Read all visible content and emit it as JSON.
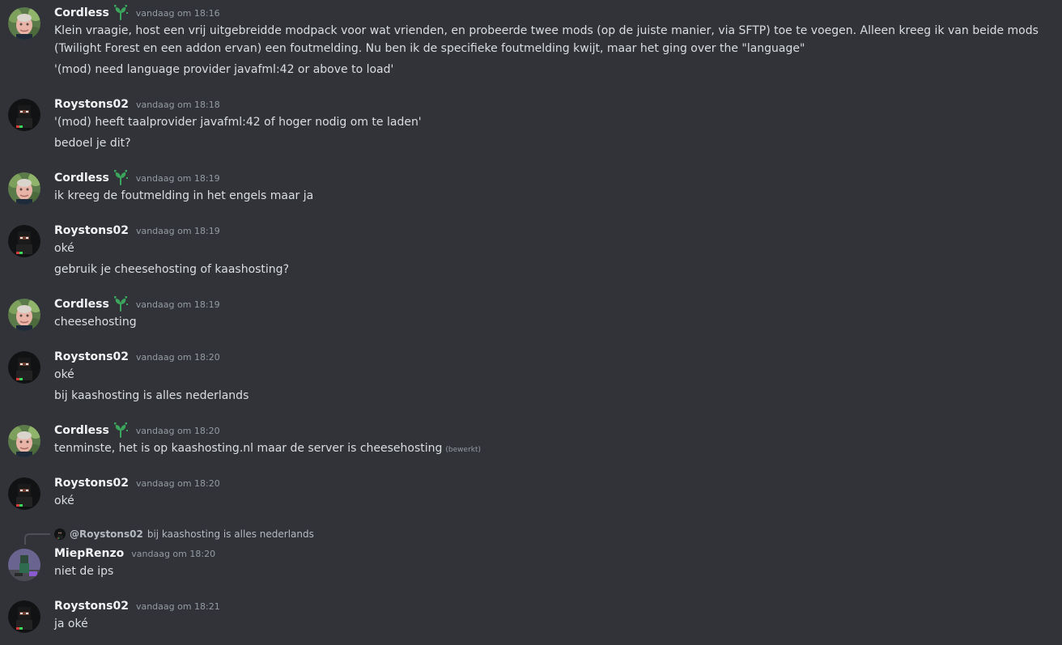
{
  "users": {
    "cordless": {
      "name": "Cordless",
      "badge": "sprout-icon"
    },
    "roystons": {
      "name": "Roystons02"
    },
    "miep": {
      "name": "MiepRenzo"
    }
  },
  "messages": [
    {
      "author": "Cordless",
      "time": "vandaag om 18:16",
      "lines": [
        "Klein vraagie, host een vrij uitgebreidde modpack voor wat vrienden, en probeerde twee mods (op de juiste manier, via SFTP) toe te voegen. Alleen kreeg ik van beide mods (Twilight Forest en een addon ervan) een foutmelding. Nu ben ik de specifieke foutmelding kwijt, maar het ging over the \"language\"",
        "'(mod) need language provider javafml:42 or above to load'"
      ]
    },
    {
      "author": "Roystons02",
      "time": "vandaag om 18:18",
      "lines": [
        "'(mod) heeft taalprovider javafml:42 of hoger nodig om te laden'",
        "bedoel je dit?"
      ]
    },
    {
      "author": "Cordless",
      "time": "vandaag om 18:19",
      "lines": [
        "ik kreeg de foutmelding in het engels maar ja"
      ]
    },
    {
      "author": "Roystons02",
      "time": "vandaag om 18:19",
      "lines": [
        "oké",
        "gebruik je cheesehosting of kaashosting?"
      ]
    },
    {
      "author": "Cordless",
      "time": "vandaag om 18:19",
      "lines": [
        "cheesehosting"
      ]
    },
    {
      "author": "Roystons02",
      "time": "vandaag om 18:20",
      "lines": [
        "oké",
        "bij kaashosting is alles nederlands"
      ]
    },
    {
      "author": "Cordless",
      "time": "vandaag om 18:20",
      "lines": [
        "tenminste, het is op kaashosting.nl maar de server is cheesehosting"
      ],
      "edited": "(bewerkt)"
    },
    {
      "author": "Roystons02",
      "time": "vandaag om 18:20",
      "lines": [
        "oké"
      ]
    },
    {
      "reply_to": {
        "user": "@Roystons02",
        "text": "bij kaashosting is alles nederlands"
      },
      "author": "MiepRenzo",
      "time": "vandaag om 18:20",
      "lines": [
        "niet de ips"
      ]
    },
    {
      "author": "Roystons02",
      "time": "vandaag om 18:21",
      "lines": [
        "ja oké"
      ]
    }
  ],
  "colors": {
    "background": "#313338",
    "username": "#f2f3f5",
    "text": "#dbdee1",
    "timestamp": "#949ba4",
    "badge_green": "#3ba55d"
  }
}
